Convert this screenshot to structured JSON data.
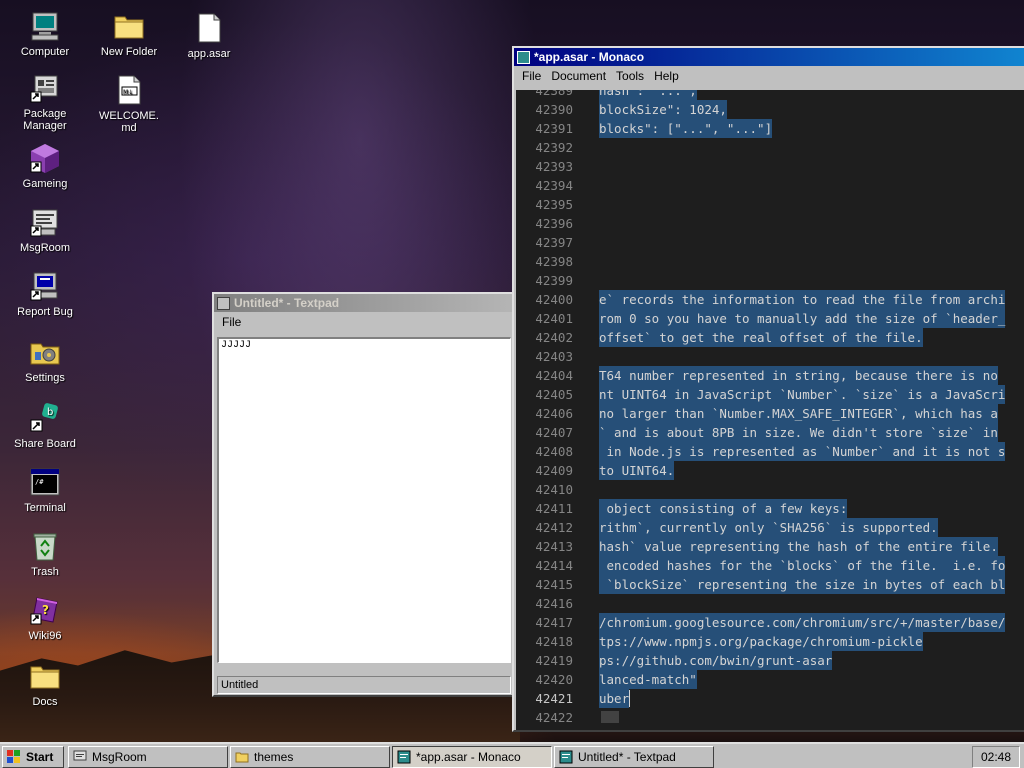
{
  "desktop": {
    "icons": [
      {
        "label": "Computer",
        "icon": "computer-icon"
      },
      {
        "label": "Package Manager",
        "icon": "package-manager-icon"
      },
      {
        "label": "Gameing",
        "icon": "cube-icon"
      },
      {
        "label": "MsgRoom",
        "icon": "msgroom-icon"
      },
      {
        "label": "Report Bug",
        "icon": "report-bug-icon"
      },
      {
        "label": "Settings",
        "icon": "settings-icon"
      },
      {
        "label": "Share Board",
        "icon": "share-board-icon"
      },
      {
        "label": "Terminal",
        "icon": "terminal-icon"
      },
      {
        "label": "Trash",
        "icon": "recycle-icon"
      },
      {
        "label": "Wiki96",
        "icon": "wiki-book-icon"
      },
      {
        "label": "Docs",
        "icon": "folder-icon"
      },
      {
        "label": "New Folder",
        "icon": "folder-icon"
      },
      {
        "label": "WELCOME.md",
        "icon": "markdown-file-icon"
      },
      {
        "label": "app.asar",
        "icon": "file-icon"
      }
    ]
  },
  "textpad": {
    "title": "Untitled* - Textpad",
    "menu": [
      "File"
    ],
    "content": "JJJJJ",
    "status": "Untitled"
  },
  "monaco": {
    "title": "*app.asar - Monaco",
    "menu": [
      "File",
      "Document",
      "Tools",
      "Help"
    ],
    "lines": [
      {
        "num": "42389",
        "text": "hash\": \"...\","
      },
      {
        "num": "42390",
        "text": "blockSize\": 1024,"
      },
      {
        "num": "42391",
        "text": "blocks\": [\"...\", \"...\"]"
      },
      {
        "num": "42392",
        "text": ""
      },
      {
        "num": "42393",
        "text": ""
      },
      {
        "num": "42394",
        "text": ""
      },
      {
        "num": "42395",
        "text": ""
      },
      {
        "num": "42396",
        "text": ""
      },
      {
        "num": "42397",
        "text": ""
      },
      {
        "num": "42398",
        "text": ""
      },
      {
        "num": "42399",
        "text": ""
      },
      {
        "num": "42400",
        "text": "e` records the information to read the file from archi"
      },
      {
        "num": "42401",
        "text": "rom 0 so you have to manually add the size of `header_"
      },
      {
        "num": "42402",
        "text": "offset` to get the real offset of the file."
      },
      {
        "num": "42403",
        "text": ""
      },
      {
        "num": "42404",
        "text": "T64 number represented in string, because there is no"
      },
      {
        "num": "42405",
        "text": "nt UINT64 in JavaScript `Number`. `size` is a JavaScri"
      },
      {
        "num": "42406",
        "text": "no larger than `Number.MAX_SAFE_INTEGER`, which has a"
      },
      {
        "num": "42407",
        "text": "` and is about 8PB in size. We didn't store `size` in"
      },
      {
        "num": "42408",
        "text": " in Node.js is represented as `Number` and it is not s"
      },
      {
        "num": "42409",
        "text": "to UINT64."
      },
      {
        "num": "42410",
        "text": ""
      },
      {
        "num": "42411",
        "text": " object consisting of a few keys:"
      },
      {
        "num": "42412",
        "text": "rithm`, currently only `SHA256` is supported."
      },
      {
        "num": "42413",
        "text": "hash` value representing the hash of the entire file."
      },
      {
        "num": "42414",
        "text": " encoded hashes for the `blocks` of the file.  i.e. fo"
      },
      {
        "num": "42415",
        "text": " `blockSize` representing the size in bytes of each bl"
      },
      {
        "num": "42416",
        "text": ""
      },
      {
        "num": "42417",
        "text": "/chromium.googlesource.com/chromium/src/+/master/base/"
      },
      {
        "num": "42418",
        "text": "tps://www.npmjs.org/package/chromium-pickle"
      },
      {
        "num": "42419",
        "text": "ps://github.com/bwin/grunt-asar"
      },
      {
        "num": "42420",
        "text": "lanced-match\""
      },
      {
        "num": "42421",
        "text": "uber"
      },
      {
        "num": "42422",
        "text": ""
      }
    ]
  },
  "taskbar": {
    "start_label": "Start",
    "buttons": [
      {
        "label": "MsgRoom"
      },
      {
        "label": "themes"
      },
      {
        "label": "*app.asar - Monaco"
      },
      {
        "label": "Untitled* - Textpad"
      }
    ],
    "clock": "02:48"
  },
  "colors": {
    "title_active": "#000080",
    "title_inactive": "#808080",
    "editor_bg": "#1e1e1e",
    "selection": "#264f78",
    "line_number": "#858585",
    "taskbar": "#c0c0c0"
  }
}
